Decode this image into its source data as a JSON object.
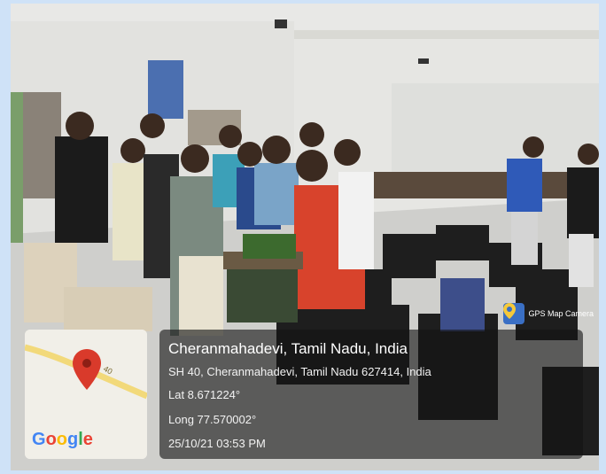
{
  "location": {
    "title": "Cheranmahadevi, Tamil Nadu, India",
    "address": "SH 40, Cheranmahadevi, Tamil Nadu 627414, India",
    "latitude": "Lat 8.671224°",
    "longitude": "Long 77.570002°",
    "timestamp": "25/10/21 03:53 PM"
  },
  "map": {
    "road_label": "40",
    "provider": "Google"
  },
  "badge": {
    "label": "GPS Map Camera",
    "icon": "location-pin-icon"
  },
  "colors": {
    "google_blue": "#4285F4",
    "google_red": "#EA4335",
    "google_yellow": "#FBBC05",
    "google_green": "#34A853",
    "pin_red": "#d93a2b"
  }
}
